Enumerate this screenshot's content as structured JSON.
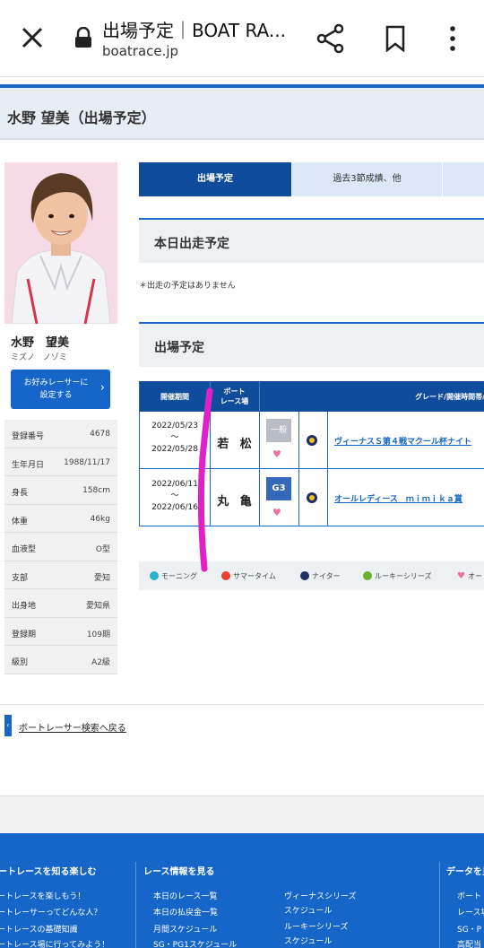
{
  "browser": {
    "title": "出場予定｜BOAT RA...",
    "url": "boatrace.jp"
  },
  "page": {
    "title": "水野 望美（出場予定）"
  },
  "profile": {
    "name": "水野　望美",
    "kana": "ミズノ ノゾミ",
    "fav_button": [
      "お好みレーサーに",
      "設定する"
    ],
    "rows": [
      {
        "k": "登録番号",
        "v": "4678"
      },
      {
        "k": "生年月日",
        "v": "1988/11/17"
      },
      {
        "k": "身長",
        "v": "158cm"
      },
      {
        "k": "体重",
        "v": "46kg"
      },
      {
        "k": "血液型",
        "v": "O型"
      },
      {
        "k": "支部",
        "v": "愛知"
      },
      {
        "k": "出身地",
        "v": "愛知県"
      },
      {
        "k": "登録期",
        "v": "109期"
      },
      {
        "k": "級別",
        "v": "A2級"
      }
    ]
  },
  "tabs": {
    "active": "出場予定",
    "second": "過去3節成績、他"
  },
  "today": {
    "title": "本日出走予定",
    "note": "＊出走の予定はありません"
  },
  "schedule": {
    "title": "出場予定",
    "headers": {
      "period": "開催期間",
      "venue": [
        "ボート",
        "レース場"
      ],
      "grade": "グレード/開催時間帯/"
    },
    "rows": [
      {
        "start": "2022/05/23",
        "tilde": "〜",
        "end": "2022/05/28",
        "venue": "若 松",
        "grade": "一般",
        "race": "ヴィーナスＳ第４戦マクール杯ナイト"
      },
      {
        "start": "2022/06/11",
        "tilde": "〜",
        "end": "2022/06/16",
        "venue": "丸 亀",
        "grade": "G3",
        "race": "オールレディース　ｍｉｍｉｋａ賞"
      }
    ]
  },
  "legend": [
    {
      "label": "モーニング",
      "color": "#2bb3c9"
    },
    {
      "label": "サマータイム",
      "color": "#e8412c"
    },
    {
      "label": "ナイター",
      "color": "#1f2f66"
    },
    {
      "label": "ルーキーシリーズ",
      "color": "#6ab42d"
    },
    {
      "label": "オー",
      "color": "#f06ea3"
    }
  ],
  "back_link": "ボートレーサー検索へ戻る",
  "footer": {
    "col1_title": "ボートレースを知る楽しむ",
    "col1": [
      "ボートレースを楽しもう！",
      "ボートレーサーってどんな人？",
      "ボートレースの基礎知識",
      "ボートレース場に行ってみよう！"
    ],
    "col2_title": "レース情報を見る",
    "col2a": [
      "本日のレース一覧",
      "本日の払戻金一覧",
      "月間スケジュール",
      "SG・PG1スケジュール"
    ],
    "col2b": [
      "ヴィーナスシリーズ",
      "スケジュール",
      "ルーキーシリーズ",
      "スケジュール"
    ],
    "col3_title": "データを見る",
    "col3": [
      "ボート",
      "レース場",
      "SG・P",
      "高配当"
    ]
  }
}
